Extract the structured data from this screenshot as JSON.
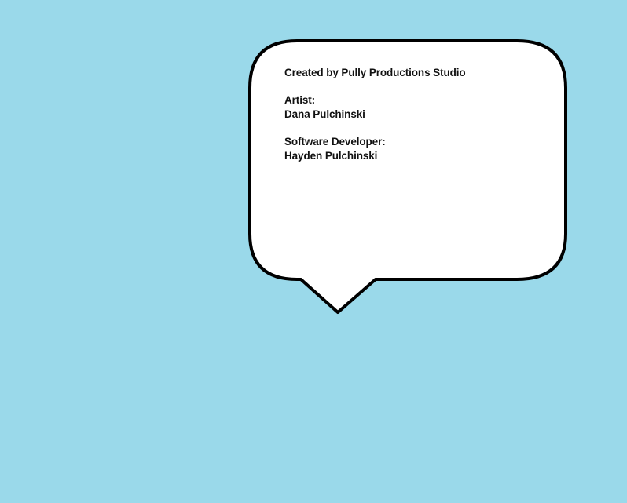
{
  "colors": {
    "background": "#9ad9ea",
    "bubble_fill": "#ffffff",
    "bubble_stroke": "#000000",
    "text": "#111111"
  },
  "credits": {
    "studio": "Created by Pully Productions Studio",
    "artist_role": "Artist:",
    "artist_name": "Dana Pulchinski",
    "developer_role": "Software Developer:",
    "developer_name": "Hayden Pulchinski"
  }
}
